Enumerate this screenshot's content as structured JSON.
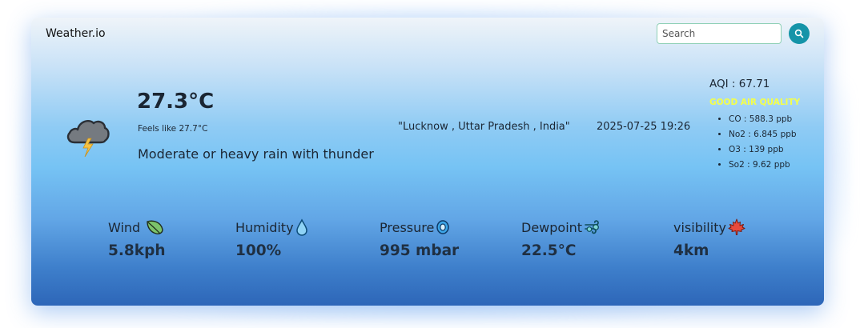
{
  "app": {
    "brand": "Weather.io"
  },
  "search": {
    "placeholder": "Search"
  },
  "current": {
    "temperature": "27.3°C",
    "feels_like": "Feels like 27.7°C",
    "condition": "Moderate or heavy rain with thunder",
    "icon": "thunder-rain-cloud-icon"
  },
  "location": "\"Lucknow , Uttar Pradesh , India\"",
  "datetime": "2025-07-25 19:26",
  "aqi": {
    "title": "AQI : 67.71",
    "quality": "GOOD AIR QUALITY",
    "quality_color": "#f4ff4a",
    "pollutants": [
      "CO : 588.3 ppb",
      "No2 : 6.845 ppb",
      "O3 : 139 ppb",
      "So2 : 9.62 ppb"
    ]
  },
  "metrics": {
    "wind": {
      "label": "Wind",
      "value": "5.8kph",
      "icon": "leaf-icon"
    },
    "humidity": {
      "label": "Humidity",
      "value": "100%",
      "icon": "droplet-icon"
    },
    "pressure": {
      "label": "Pressure",
      "value": "995 mbar",
      "icon": "pressure-swirl-icon"
    },
    "dewpoint": {
      "label": "Dewpoint",
      "value": "22.5°C",
      "icon": "dewpoint-wind-icon"
    },
    "visibility": {
      "label": "visibility",
      "value": "4km",
      "icon": "maple-leaf-icon"
    }
  },
  "colors": {
    "accent": "#1594a8",
    "card_top": "#eff4f9",
    "card_bottom": "#2d66b8"
  }
}
